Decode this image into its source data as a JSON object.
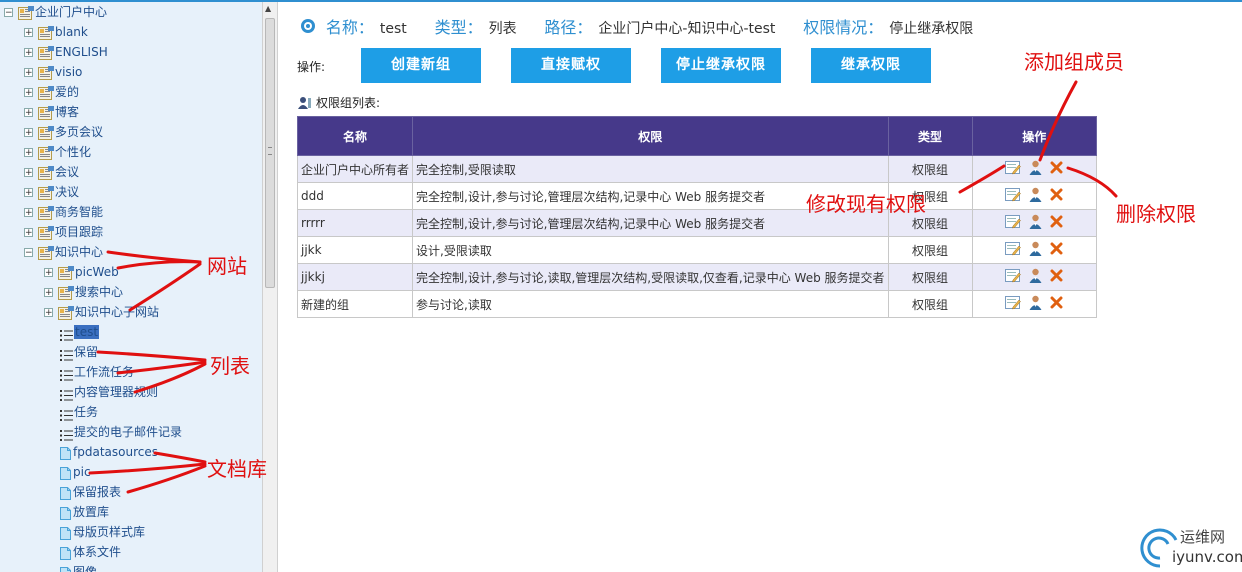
{
  "sidebar": {
    "root": {
      "label": "企业门户中心",
      "toggle": "⊟"
    },
    "sites": [
      {
        "label": "blank",
        "toggle": "⊞"
      },
      {
        "label": "ENGLISH",
        "toggle": "⊞"
      },
      {
        "label": "visio",
        "toggle": "⊞"
      },
      {
        "label": "爱的",
        "toggle": "⊞"
      },
      {
        "label": "博客",
        "toggle": "⊞"
      },
      {
        "label": "多页会议",
        "toggle": "⊞"
      },
      {
        "label": "个性化",
        "toggle": "⊞"
      },
      {
        "label": "会议",
        "toggle": "⊞"
      },
      {
        "label": "决议",
        "toggle": "⊞"
      },
      {
        "label": "商务智能",
        "toggle": "⊞"
      },
      {
        "label": "项目跟踪",
        "toggle": "⊞"
      },
      {
        "label": "知识中心",
        "toggle": "⊟"
      }
    ],
    "subsites": [
      {
        "label": "picWeb",
        "toggle": "⊞"
      },
      {
        "label": "搜索中心",
        "toggle": "⊞"
      },
      {
        "label": "知识中心子网站",
        "toggle": "⊞"
      }
    ],
    "lists": [
      {
        "label": "test",
        "selected": true
      },
      {
        "label": "保留"
      },
      {
        "label": "工作流任务"
      },
      {
        "label": "内容管理器规则"
      },
      {
        "label": "任务"
      },
      {
        "label": "提交的电子邮件记录"
      }
    ],
    "doclibs": [
      {
        "label": "fpdatasources"
      },
      {
        "label": "pic"
      },
      {
        "label": "保留报表"
      },
      {
        "label": "放置库"
      },
      {
        "label": "母版页样式库"
      },
      {
        "label": "体系文件"
      },
      {
        "label": "图像"
      }
    ]
  },
  "info": {
    "name_label": "名称：",
    "name_value": "test",
    "type_label": "类型：",
    "type_value": "列表",
    "path_label": "路径：",
    "path_value": "企业门户中心-知识中心-test",
    "perm_label": "权限情况：",
    "perm_value": "停止继承权限"
  },
  "toolbar": {
    "label": "操作:",
    "buttons": [
      "创建新组",
      "直接赋权",
      "停止继承权限",
      "继承权限"
    ]
  },
  "group_list": {
    "title": "权限组列表:",
    "columns": [
      "名称",
      "权限",
      "类型",
      "操作"
    ],
    "rows": [
      {
        "name": "企业门户中心所有者",
        "perm": "完全控制,受限读取",
        "type": "权限组"
      },
      {
        "name": "ddd",
        "perm": "完全控制,设计,参与讨论,管理层次结构,记录中心 Web 服务提交者",
        "type": "权限组"
      },
      {
        "name": "rrrrr",
        "perm": "完全控制,设计,参与讨论,管理层次结构,记录中心 Web 服务提交者",
        "type": "权限组"
      },
      {
        "name": "jjkk",
        "perm": "设计,受限读取",
        "type": "权限组"
      },
      {
        "name": "jjkkj",
        "perm": "完全控制,设计,参与讨论,读取,管理层次结构,受限读取,仅查看,记录中心 Web 服务提交者",
        "type": "权限组"
      },
      {
        "name": "新建的组",
        "perm": "参与讨论,读取",
        "type": "权限组"
      }
    ],
    "op_icons": [
      "edit-icon",
      "add-member-icon",
      "delete-icon"
    ]
  },
  "annotations": {
    "site": "网站",
    "list": "列表",
    "doclib": "文档库",
    "add_member": "添加组成员",
    "modify": "修改现有权限",
    "delete": "删除权限"
  },
  "watermark": {
    "title": "运维网",
    "url": "iyunv.com"
  },
  "colors": {
    "accent": "#2f8fd0",
    "button": "#1e9ee6",
    "header": "#46398a",
    "annotation": "#e01010"
  }
}
